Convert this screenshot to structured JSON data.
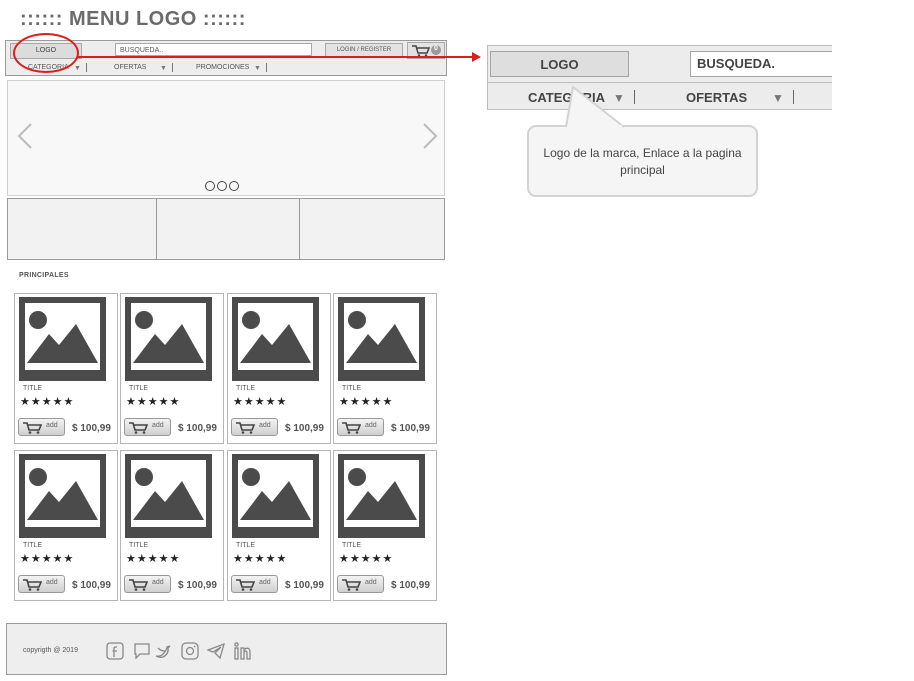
{
  "heading": ":::::: MENU LOGO ::::::",
  "header": {
    "logo_label": "LOGO",
    "search_value": "BUSQUEDA..",
    "login_label": "LOGIN / REGISTER",
    "cart_count": "0"
  },
  "menu": {
    "items": [
      "CATEGORIA",
      "OFERTAS",
      "PROMOCIONES"
    ]
  },
  "section_title": "PRINCIPALES",
  "products": [
    {
      "title": "TITLE",
      "stars": "★★★★★",
      "add_label": "add",
      "price": "$ 100,99"
    },
    {
      "title": "TITLE",
      "stars": "★★★★★",
      "add_label": "add",
      "price": "$ 100,99"
    },
    {
      "title": "TITLE",
      "stars": "★★★★★",
      "add_label": "add",
      "price": "$ 100,99"
    },
    {
      "title": "TITLE",
      "stars": "★★★★★",
      "add_label": "add",
      "price": "$ 100,99"
    },
    {
      "title": "TITLE",
      "stars": "★★★★★",
      "add_label": "add",
      "price": "$ 100,99"
    },
    {
      "title": "TITLE",
      "stars": "★★★★★",
      "add_label": "add",
      "price": "$ 100,99"
    },
    {
      "title": "TITLE",
      "stars": "★★★★★",
      "add_label": "add",
      "price": "$ 100,99"
    },
    {
      "title": "TITLE",
      "stars": "★★★★★",
      "add_label": "add",
      "price": "$ 100,99"
    }
  ],
  "footer": {
    "copyright": "copyrigth @ 2019",
    "social_icons": [
      "facebook-icon",
      "chat-icon",
      "twitter-icon",
      "instagram-icon",
      "telegram-icon",
      "linkedin-icon"
    ]
  },
  "zoom": {
    "logo_label": "LOGO",
    "search_value": "BUSQUEDA.",
    "menu_items": [
      "CATEGORIA",
      "OFERTAS"
    ]
  },
  "callout_text": "Logo de la marca, Enlace a la pagina principal",
  "colors": {
    "annotation": "#e01b1b",
    "wire_dark": "#4b4b4b",
    "wire_bg": "#ededed"
  }
}
